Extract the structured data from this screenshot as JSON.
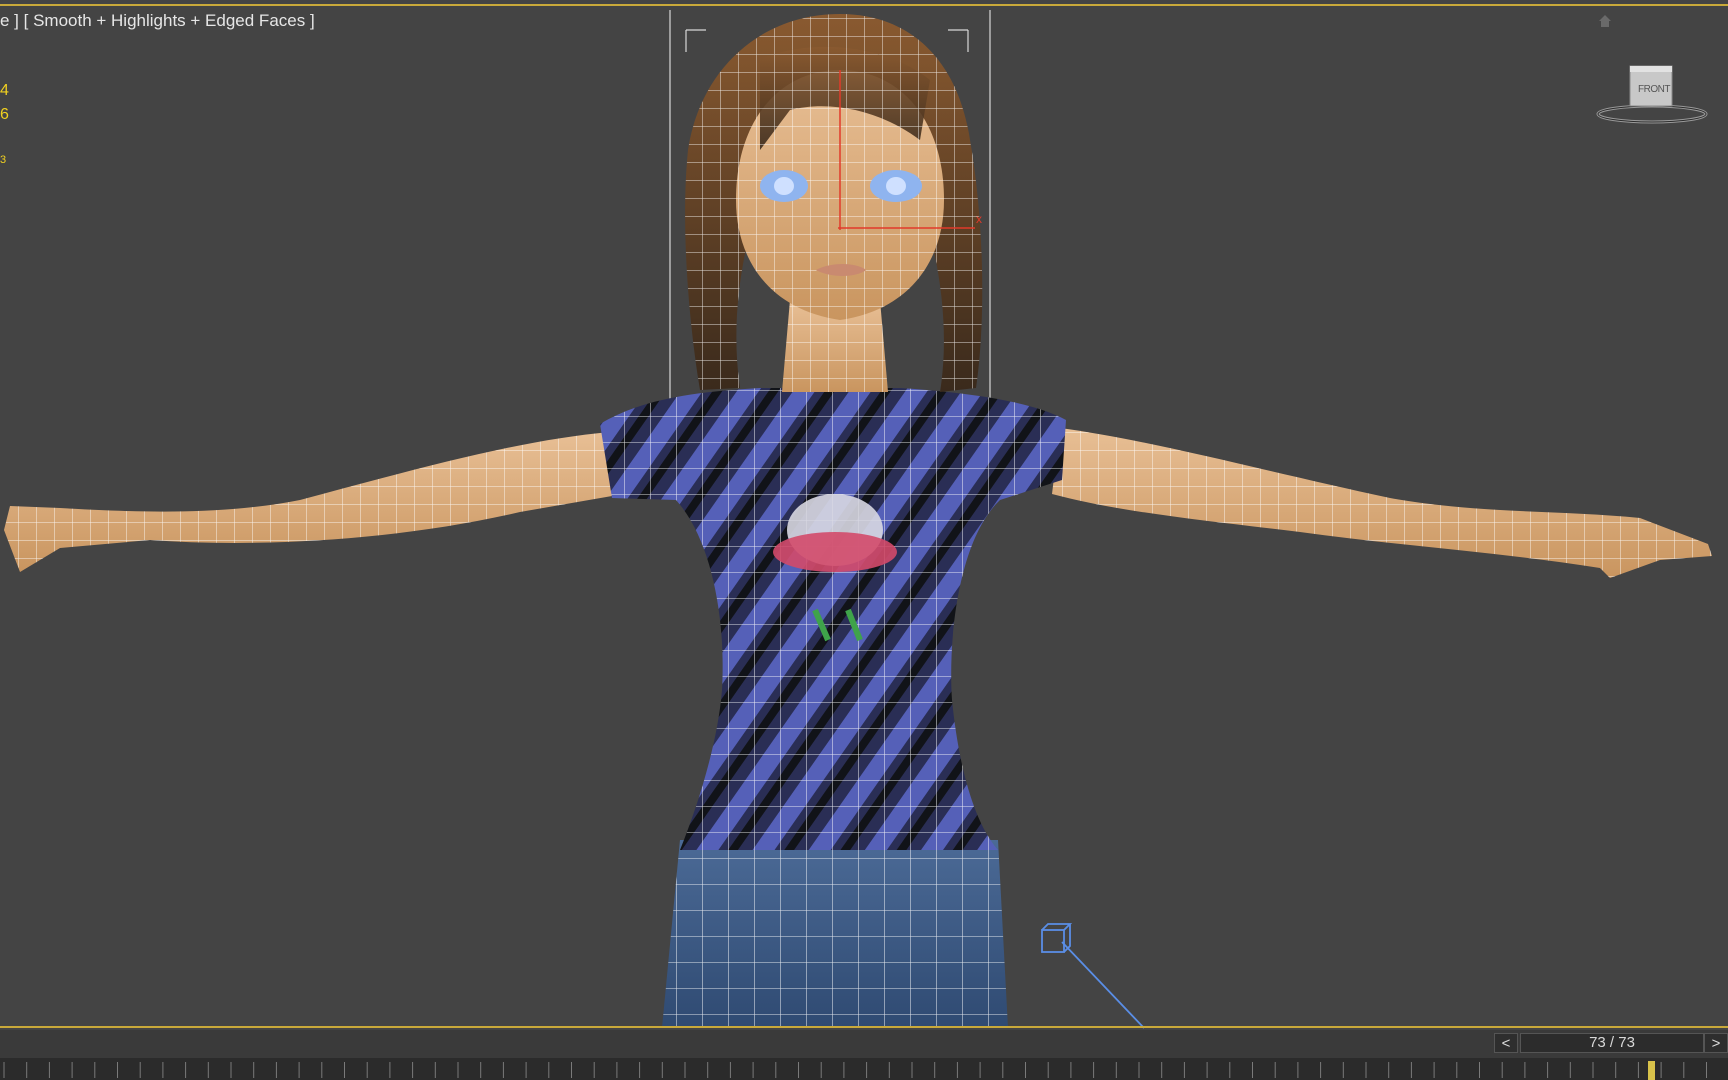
{
  "viewport": {
    "label": "e ] [ Smooth + Highlights + Edged Faces ]",
    "stats": [
      "4",
      "6",
      "3"
    ],
    "viewcube_label": "FRONT",
    "accent_color": "#c9a93a",
    "stat_color": "#f0d020"
  },
  "timeline": {
    "prev_label": "<",
    "frame_display": "73 / 73",
    "next_label": ">",
    "current_frame": 73,
    "total_frames": 73
  },
  "icons": {
    "home": "home-icon",
    "viewcube": "viewcube-icon",
    "camera": "camera-target-icon"
  }
}
